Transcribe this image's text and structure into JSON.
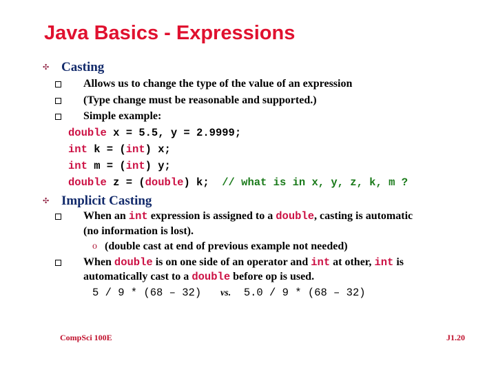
{
  "title": "Java Basics - Expressions",
  "sections": [
    {
      "heading": "Casting",
      "items": [
        "Allows us to change the type of the value of an expression",
        "(Type change must be reasonable and supported.)",
        "Simple example:"
      ],
      "code": [
        {
          "kw1": "double",
          "rest": " x = 5.5, y = 2.9999;"
        },
        {
          "kw1": "int",
          "a": " k = (",
          "kw2": "int",
          "b": ") x;"
        },
        {
          "kw1": "int",
          "a": " m = (",
          "kw2": "int",
          "b": ") y;"
        },
        {
          "kw1": "double",
          "a": " z = (",
          "kw2": "double",
          "b": ") k;  ",
          "comment": "// what is in x, y, z, k, m ?"
        }
      ]
    },
    {
      "heading": "Implicit Casting",
      "item1": {
        "p1": "When an ",
        "c1": "int",
        "p2": " expression is assigned to a ",
        "c2": "double",
        "p3": ", casting is automatic",
        "line2": "(no information is lost).",
        "sub": "(double cast at end of previous example not needed)"
      },
      "item2": {
        "p1": "When ",
        "c1": "double",
        "p2": " is on one side of an operator and ",
        "c2": "int",
        "p3": " at other, ",
        "c3": "int",
        "p4": " is",
        "l2a": "automatically cast to a ",
        "c4": "double",
        "l2b": " before op is used."
      },
      "expression": {
        "left": "5 / 9 * (68 – 32)",
        "vs": "vs.",
        "right": "5.0 / 9 * (68 – 32)"
      }
    }
  ],
  "icons": {
    "level1_bullet": "four-diamond-bullet-icon",
    "level2_bullet": "hollow-square-bullet-icon",
    "level3_bullet": "circle-bullet-icon"
  },
  "footer": {
    "left": "CompSci 100E",
    "right": "J1.20"
  },
  "colors": {
    "title": "#e0112f",
    "heading": "#122a6b",
    "keyword": "#cc1144",
    "comment": "#1a7a1a",
    "footer": "#c0102c"
  }
}
